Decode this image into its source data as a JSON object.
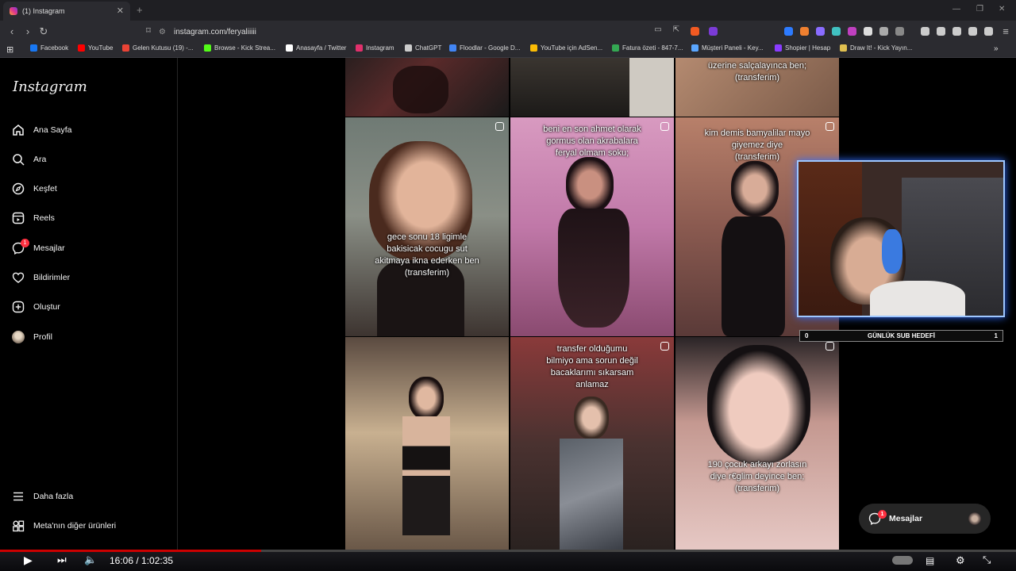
{
  "browser": {
    "tab_title": "(1) Instagram",
    "url": "instagram.com/feryaliiiii",
    "bookmarks": [
      {
        "label": "Facebook",
        "color": "#1877f2"
      },
      {
        "label": "YouTube",
        "color": "#ff0000"
      },
      {
        "label": "Gelen Kutusu (19) -...",
        "color": "#ea4335"
      },
      {
        "label": "Browse - Kick Strea...",
        "color": "#53fc18"
      },
      {
        "label": "Anasayfa / Twitter",
        "color": "#ffffff"
      },
      {
        "label": "Instagram",
        "color": "#e1306c"
      },
      {
        "label": "ChatGPT",
        "color": "#cccccc"
      },
      {
        "label": "Floodlar - Google D...",
        "color": "#4285f4"
      },
      {
        "label": "YouTube için AdSen...",
        "color": "#fbbc05"
      },
      {
        "label": "Fatura özeti - 847-7...",
        "color": "#34a853"
      },
      {
        "label": "Müşteri Paneli - Key...",
        "color": "#5aa6ff"
      },
      {
        "label": "Shopier | Hesap",
        "color": "#8a3cff"
      },
      {
        "label": "Draw It! - Kick Yayın...",
        "color": "#e0c050"
      }
    ]
  },
  "sidebar": {
    "logo": "Instagram",
    "items": [
      {
        "label": "Ana Sayfa",
        "icon": "home-icon"
      },
      {
        "label": "Ara",
        "icon": "search-icon"
      },
      {
        "label": "Keşfet",
        "icon": "compass-icon"
      },
      {
        "label": "Reels",
        "icon": "reels-icon"
      },
      {
        "label": "Mesajlar",
        "icon": "messenger-icon",
        "badge": "1"
      },
      {
        "label": "Bildirimler",
        "icon": "heart-icon"
      },
      {
        "label": "Oluştur",
        "icon": "plus-square-icon"
      },
      {
        "label": "Profil",
        "icon": "avatar-icon"
      }
    ],
    "bottom": [
      {
        "label": "Daha fazla",
        "icon": "menu-icon"
      },
      {
        "label": "Meta'nın diğer ürünleri",
        "icon": "apps-icon"
      }
    ]
  },
  "grid": {
    "captions": {
      "top_right": "üzerine salçalayınca ben;\n(transferim)",
      "r1c1": "gece sonu 18 ligimle\nbakisicak cocugu sut\nakitmaya ikna ederken ben\n(transferim)",
      "r1c2": "beni en son ahmet olarak\ngormus olan akrabalara\nferyal olmam soku;",
      "r1c3": "kim demis bamyalilar mayo\ngiyemez diye\n(transferim)",
      "r2c2": "transfer olduğumu\nbilmiyo ama sorun değil\nbacaklarımı sıkarsam\nanlamaz",
      "r2c3": "190 çocuk arkayı zorlasın\ndiye r€glim deyince ben;\n(transferim)"
    }
  },
  "overlay": {
    "sub_goal_label": "GÜNLÜK SUB HEDEFİ",
    "sub_goal_current": "0",
    "sub_goal_target": "1"
  },
  "messages_pill": {
    "label": "Mesajlar",
    "badge": "1"
  },
  "player": {
    "time": "16:06 / 1:02:35",
    "progress_fraction": 0.257
  }
}
